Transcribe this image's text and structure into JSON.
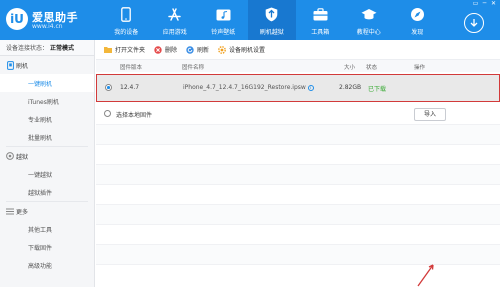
{
  "app": {
    "logo_mark": "iU",
    "name": "爱思助手",
    "url": "www.i4.cn"
  },
  "nav": [
    {
      "label": "我的设备",
      "icon": "phone-icon"
    },
    {
      "label": "应用游戏",
      "icon": "app-store-icon"
    },
    {
      "label": "铃声壁纸",
      "icon": "music-folder-icon"
    },
    {
      "label": "刷机越狱",
      "icon": "shield-icon",
      "active": true
    },
    {
      "label": "工具箱",
      "icon": "toolbox-icon"
    },
    {
      "label": "教程中心",
      "icon": "graduation-cap-icon"
    },
    {
      "label": "发现",
      "icon": "compass-icon"
    }
  ],
  "window_controls": [
    "▭",
    "─",
    "✕"
  ],
  "sidebar": {
    "status_label": "设备连接状态：",
    "status_value": "正常模式",
    "flash": {
      "label": "刷机",
      "items": [
        "一键刷机",
        "iTunes刷机",
        "专业刷机",
        "批量刷机"
      ]
    },
    "jailbreak": {
      "label": "越狱",
      "items": [
        "一键越狱",
        "越狱插件"
      ]
    },
    "more": {
      "label": "更多",
      "items": [
        "其他工具",
        "下载固件",
        "高级功能"
      ]
    }
  },
  "toolbar": {
    "open_folder": "打开文件夹",
    "delete": "删除",
    "refresh": "刷新",
    "settings": "设备刷机设置"
  },
  "table": {
    "headers": [
      "固件版本",
      "固件名称",
      "大小",
      "状态",
      "操作"
    ],
    "rows": [
      {
        "version": "12.4.7",
        "name": "iPhone_4.7_12.4.7_16G192_Restore.ipsw",
        "size": "2.82GB",
        "status": "已下载",
        "selected": true
      }
    ],
    "local_option": "选择本地固件",
    "import_label": "导入"
  },
  "colors": {
    "header": "#1e8de8",
    "active_nav": "#1878d0",
    "status_ok": "#3aaa35",
    "highlight": "#d23a3a"
  }
}
